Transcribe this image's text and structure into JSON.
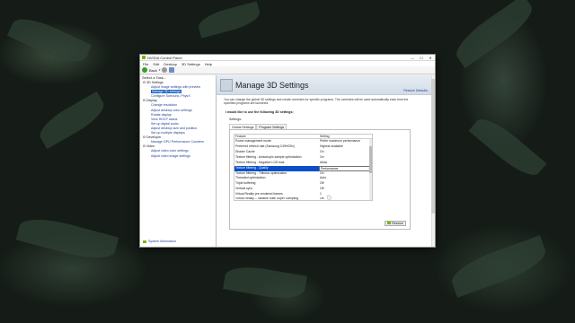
{
  "window": {
    "title": "NVIDIA Control Panel",
    "min": "—",
    "max": "☐",
    "close": "✕"
  },
  "menu": [
    "File",
    "Edit",
    "Desktop",
    "3D Settings",
    "Help"
  ],
  "toolbar": {
    "back": "Back"
  },
  "left": {
    "task_label": "Select a Task...",
    "sysinfo": "System Information",
    "tree": [
      {
        "label": "3D Settings",
        "level": "cat"
      },
      {
        "label": "Adjust image settings with preview",
        "level": "sub"
      },
      {
        "label": "Manage 3D settings",
        "level": "sub",
        "selected": true
      },
      {
        "label": "Configure Surround, PhysX",
        "level": "sub"
      },
      {
        "label": "Display",
        "level": "cat"
      },
      {
        "label": "Change resolution",
        "level": "sub"
      },
      {
        "label": "Adjust desktop color settings",
        "level": "sub"
      },
      {
        "label": "Rotate display",
        "level": "sub"
      },
      {
        "label": "View HDCP status",
        "level": "sub"
      },
      {
        "label": "Set up digital audio",
        "level": "sub"
      },
      {
        "label": "Adjust desktop size and position",
        "level": "sub"
      },
      {
        "label": "Set up multiple displays",
        "level": "sub"
      },
      {
        "label": "Developer",
        "level": "cat"
      },
      {
        "label": "Manage GPU Performance Counters",
        "level": "sub"
      },
      {
        "label": "Video",
        "level": "cat"
      },
      {
        "label": "Adjust video color settings",
        "level": "sub"
      },
      {
        "label": "Adjust video image settings",
        "level": "sub"
      }
    ]
  },
  "main": {
    "title": "Manage 3D Settings",
    "restore_defaults": "Restore Defaults",
    "description": "You can change the global 3D settings and create overrides for specific programs. The overrides will be used automatically each time the specified programs are launched.",
    "would_like": "I would like to use the following 3D settings:",
    "settings_label": "Settings:",
    "tabs": [
      "Global Settings",
      "Program Settings"
    ],
    "table_header": {
      "feature": "Feature",
      "setting": "Setting"
    },
    "rows": [
      {
        "feature": "Power management mode",
        "setting": "Prefer maximum performance"
      },
      {
        "feature": "Preferred refresh rate (Samsung C49HG9x)",
        "setting": "Highest available"
      },
      {
        "feature": "Shader Cache",
        "setting": "On"
      },
      {
        "feature": "Texture filtering - Anisotropic sample optimization",
        "setting": "On"
      },
      {
        "feature": "Texture filtering - Negative LOD bias",
        "setting": "Allow"
      },
      {
        "feature": "Texture filtering - Quality",
        "setting": "Performance",
        "selected": true
      },
      {
        "feature": "Texture filtering - Trilinear optimization",
        "setting": "On"
      },
      {
        "feature": "Threaded optimization",
        "setting": "Auto"
      },
      {
        "feature": "Triple buffering",
        "setting": "Off"
      },
      {
        "feature": "Vertical sync",
        "setting": "Off"
      },
      {
        "feature": "Virtual Reality pre-rendered frames",
        "setting": "1"
      },
      {
        "feature": "Virtual Reality – Variable Rate Super Sampling",
        "setting": "Off"
      }
    ],
    "restore_button": "Restore"
  }
}
